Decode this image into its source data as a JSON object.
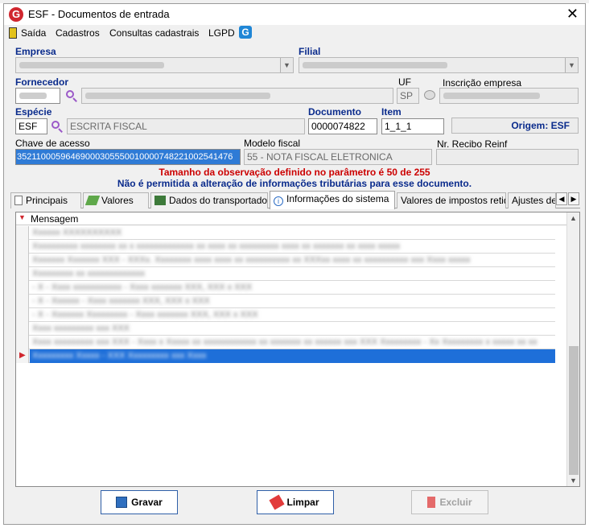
{
  "window": {
    "title": "ESF - Documentos de entrada",
    "close_glyph": "✕"
  },
  "menu": {
    "items": [
      "Saída",
      "Cadastros",
      "Consultas cadastrais",
      "LGPD"
    ],
    "lgpd_icon": "G"
  },
  "form": {
    "empresa": {
      "label": "Empresa"
    },
    "filial": {
      "label": "Filial"
    },
    "fornecedor": {
      "label": "Fornecedor"
    },
    "uf": {
      "label": "UF",
      "value": "SP"
    },
    "inscricao": {
      "label": "Inscrição empresa"
    },
    "especie": {
      "label": "Espécie",
      "code": "ESF",
      "description": "ESCRITA FISCAL"
    },
    "documento": {
      "label": "Documento",
      "value": "0000074822"
    },
    "item": {
      "label": "Item",
      "value": "1_1_1"
    },
    "origem": {
      "text": "Origem: ESF"
    },
    "chave": {
      "label": "Chave de acesso",
      "value": "35211000596469000305550010000748221002541476"
    },
    "modelo": {
      "label": "Modelo fiscal",
      "value": "55 - NOTA FISCAL ELETRONICA"
    },
    "recibo": {
      "label": "Nr. Recibo Reinf",
      "value": ""
    }
  },
  "messages": {
    "warning": "Tamanho da observação definido no parâmetro é 50 de 255",
    "info": "Não é permitida a alteração de informações tributárias para esse documento."
  },
  "tabs": [
    {
      "label": "Principais",
      "icon": "document-icon"
    },
    {
      "label": "Valores",
      "icon": "money-icon"
    },
    {
      "label": "Dados do transportador",
      "icon": "truck-icon"
    },
    {
      "label": "Informações do sistema",
      "icon": "info-icon",
      "active": true
    },
    {
      "label": "Valores de impostos retidos"
    },
    {
      "label": "Ajustes de"
    }
  ],
  "grid": {
    "header": "Mensagem",
    "rows": [
      "Xxxxxx XXXXXXXXXX",
      "Xxxxxxxxxx xxxxxxxx xx x xxxxxxxxxxxxx xx xxxx xx xxxxxxxxx xxxx xx xxxxxxx xx xxxx xxxxx",
      "Xxxxxxx Xxxxxxx XXX - XXXx. Xxxxxxxx xxxx xxxx xx xxxxxxxxxx xx XXXxx xxxx xx xxxxxxxxxx xxx Xxxx xxxxx",
      "Xxxxxxxxx xx xxxxxxxxxxxxx",
      "- X - Xxxx xxxxxxxxxxx - Xxxx xxxxxxx XXX, XXX x XXX",
      "- X - Xxxxxx - Xxxx xxxxxxx XXX, XXX x XXX",
      "- X - Xxxxxxx Xxxxxxxxx - Xxxx xxxxxxx XXX, XXX x XXX",
      "Xxxx xxxxxxxxx xxx XXX",
      "Xxxx xxxxxxxxx xxx XXX - Xxxx x Xxxxx xx xxxxxxxxxxxx xx xxxxxxx xx xxxxxx xxx XXX Xxxxxxxxx - Xx Xxxxxxxxx x xxxxx xx xx",
      "Xxxxxxxxx Xxxxx - XXX Xxxxxxxxx xxx Xxxx"
    ],
    "selected_index": 9
  },
  "buttons": {
    "gravar": "Gravar",
    "limpar": "Limpar",
    "excluir": "Excluir"
  }
}
